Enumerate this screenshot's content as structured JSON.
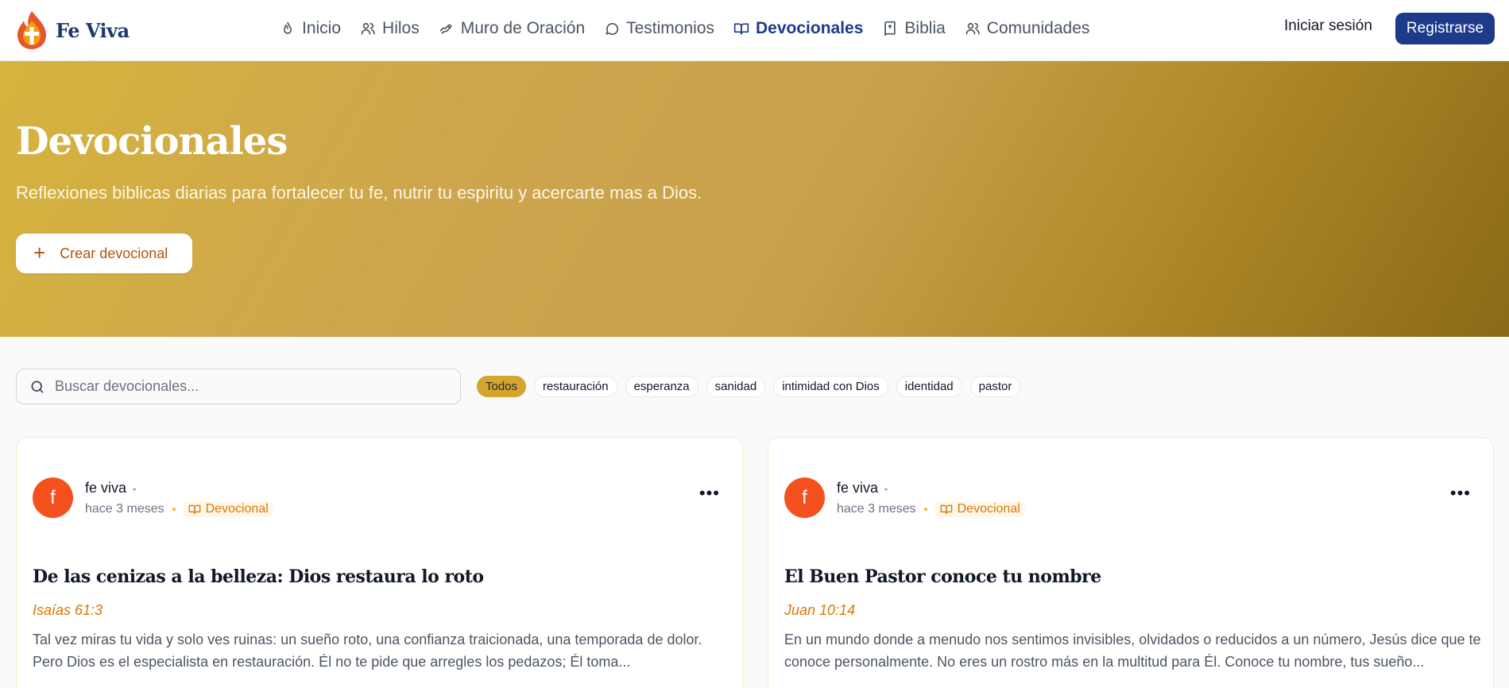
{
  "brand": {
    "name": "Fe Viva"
  },
  "nav": [
    {
      "label": "Inicio",
      "icon": "flame-icon",
      "active": false
    },
    {
      "label": "Hilos",
      "icon": "users-icon",
      "active": false
    },
    {
      "label": "Muro de Oración",
      "icon": "hand-icon",
      "active": false
    },
    {
      "label": "Testimonios",
      "icon": "message-icon",
      "active": false
    },
    {
      "label": "Devocionales",
      "icon": "book-open-icon",
      "active": true
    },
    {
      "label": "Biblia",
      "icon": "bible-icon",
      "active": false
    },
    {
      "label": "Comunidades",
      "icon": "community-icon",
      "active": false
    }
  ],
  "auth": {
    "login": "Iniciar sesión",
    "register": "Registrarse"
  },
  "hero": {
    "title": "Devocionales",
    "subtitle": "Reflexiones biblicas diarias para fortalecer tu fe, nutrir tu espiritu y acercarte mas a Dios.",
    "create_button": "Crear devocional"
  },
  "search": {
    "placeholder": "Buscar devocionales...",
    "value": ""
  },
  "filters": [
    "Todos",
    "restauración",
    "esperanza",
    "sanidad",
    "intimidad con Dios",
    "identidad",
    "pastor"
  ],
  "active_filter": "Todos",
  "posts": [
    {
      "avatar_letter": "f",
      "author": "fe viva",
      "time": "hace 3 meses",
      "badge": "Devocional",
      "title": "De las cenizas a la belleza: Dios restaura lo roto",
      "verse": "Isaías 61:3",
      "excerpt": "Tal vez miras tu vida y solo ves ruinas: un sueño roto, una confianza traicionada, una temporada de dolor. Pero Dios es el especialista en restauración. Él no te pide que arregles los pedazos; Él toma..."
    },
    {
      "avatar_letter": "f",
      "author": "fe viva",
      "time": "hace 3 meses",
      "badge": "Devocional",
      "title": "El Buen Pastor conoce tu nombre",
      "verse": "Juan 10:14",
      "excerpt": "En un mundo donde a menudo nos sentimos invisibles, olvidados o reducidos a un número, Jesús dice que te conoce personalmente. No eres un rostro más en la multitud para Él. Conoce tu nombre, tus sueño..."
    }
  ],
  "colors": {
    "primary": "#1e3a8a",
    "accent_gold": "#d4a52f",
    "verse_orange": "#d97706",
    "avatar": "#f4511e"
  }
}
